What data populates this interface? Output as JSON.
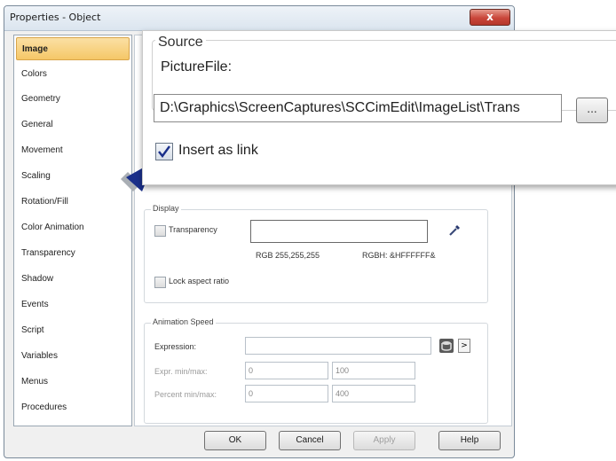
{
  "window": {
    "title": "Properties - Object",
    "close_glyph": "x"
  },
  "nav": {
    "items": [
      {
        "label": "Image",
        "selected": true
      },
      {
        "label": "Colors"
      },
      {
        "label": "Geometry"
      },
      {
        "label": "General"
      },
      {
        "label": "Movement"
      },
      {
        "label": "Scaling"
      },
      {
        "label": "Rotation/Fill"
      },
      {
        "label": "Color Animation"
      },
      {
        "label": "Transparency"
      },
      {
        "label": "Shadow"
      },
      {
        "label": "Events"
      },
      {
        "label": "Script"
      },
      {
        "label": "Variables"
      },
      {
        "label": "Menus"
      },
      {
        "label": "Procedures"
      }
    ]
  },
  "source": {
    "group_label": "Source",
    "picture_file_label": "PictureFile:",
    "path_value": "D:\\Graphics\\ScreenCaptures\\SCCimEdit\\ImageList\\Trans",
    "browse_label": "...",
    "insert_link_label": "Insert as link",
    "insert_link_checked": true
  },
  "display": {
    "group_label": "Display",
    "transparency_label": "Transparency",
    "transparency_checked": false,
    "rgb_text": "RGB 255,255,255",
    "rgbh_text": "RGBH: &HFFFFFF&",
    "lock_label": "Lock aspect ratio",
    "lock_checked": false,
    "picker_icon": "eyedropper-icon"
  },
  "animation": {
    "group_label": "Animation Speed",
    "expression_label": "Expression:",
    "expression_value": "",
    "expr_minmax_label": "Expr. min/max:",
    "expr_min": "0",
    "expr_max": "100",
    "percent_minmax_label": "Percent min/max:",
    "percent_min": "0",
    "percent_max": "400",
    "db_icon": "database-icon",
    "arrow_label": ">"
  },
  "buttons": {
    "ok": "OK",
    "cancel": "Cancel",
    "apply": "Apply",
    "help": "Help"
  },
  "colors": {
    "accent": "#1a2f8a",
    "nav_selected": "#f5c767",
    "close": "#c9463a"
  }
}
